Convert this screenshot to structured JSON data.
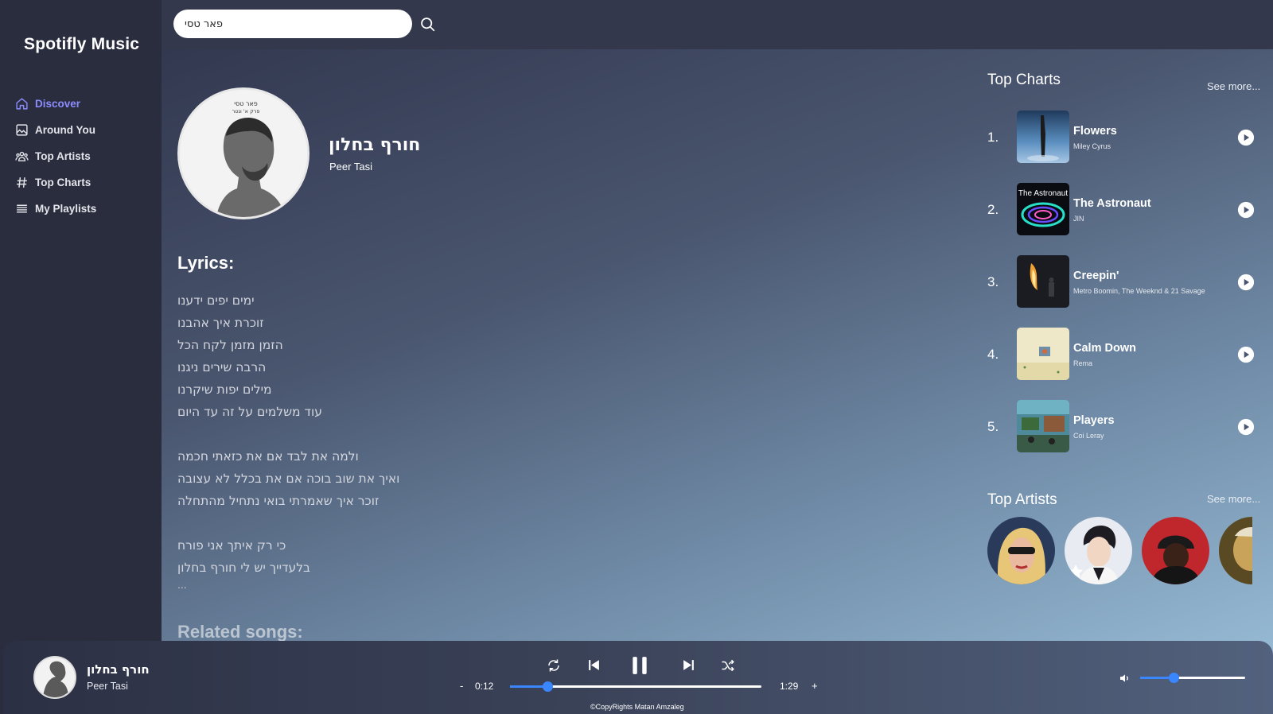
{
  "app": {
    "title": "Spotifly Music"
  },
  "sidebar": {
    "items": [
      {
        "label": "Discover",
        "icon": "home-icon",
        "active": true
      },
      {
        "label": "Around You",
        "icon": "image-icon"
      },
      {
        "label": "Top Artists",
        "icon": "users-icon"
      },
      {
        "label": "Top Charts",
        "icon": "hash-icon"
      },
      {
        "label": "My Playlists",
        "icon": "list-icon"
      }
    ]
  },
  "search": {
    "value": "פאר טסי",
    "icon": "search-icon"
  },
  "song": {
    "title": "חורף בחלון",
    "artist": "Peer Tasi",
    "cover_text_1": "פאר טסי",
    "cover_text_2": "פרק א' ונטר"
  },
  "lyrics": {
    "heading": "Lyrics:",
    "stanza1": [
      "ימים יפים ידענו",
      "זוכרת איך אהבנו",
      "הזמן מזמן לקח הכל",
      "הרבה שירים ניגנו",
      "מילים יפות שיקרנו",
      "עוד משלמים על זה עד היום"
    ],
    "stanza2": [
      "ולמה את לבד אם את כזאתי חכמה",
      "ואיך את שוב בוכה אם את בכלל לא עצובה",
      "זוכר איך שאמרתי בואי נתחיל מהתחלה"
    ],
    "stanza3": [
      "כי רק איתך אני פורח",
      "בלעדייך יש לי חורף בחלון"
    ],
    "more": "..."
  },
  "related": {
    "heading": "Related songs:"
  },
  "top_charts": {
    "heading": "Top Charts",
    "see_more": "See more...",
    "items": [
      {
        "rank": "1.",
        "title": "Flowers",
        "artist": "Miley Cyrus"
      },
      {
        "rank": "2.",
        "title": "The Astronaut",
        "artist": "JIN",
        "thumb_text": "The Astronaut"
      },
      {
        "rank": "3.",
        "title": "Creepin'",
        "artist": "Metro Boomin, The Weeknd & 21 Savage"
      },
      {
        "rank": "4.",
        "title": "Calm Down",
        "artist": "Rema"
      },
      {
        "rank": "5.",
        "title": "Players",
        "artist": "Coi Leray"
      }
    ]
  },
  "top_artists": {
    "heading": "Top Artists",
    "see_more": "See more..."
  },
  "player": {
    "title": "חורף בחלון",
    "artist": "Peer Tasi",
    "minus": "-",
    "plus": "+",
    "elapsed": "0:12",
    "duration": "1:29",
    "progress": 0.15,
    "volume": 0.32,
    "state": "playing",
    "copyright": "©CopyRights Matan Amzaleg"
  },
  "colors": {
    "accent": "#3a86ff",
    "active_nav": "#8b8cff",
    "sidebar_bg": "#2a2d3d"
  }
}
